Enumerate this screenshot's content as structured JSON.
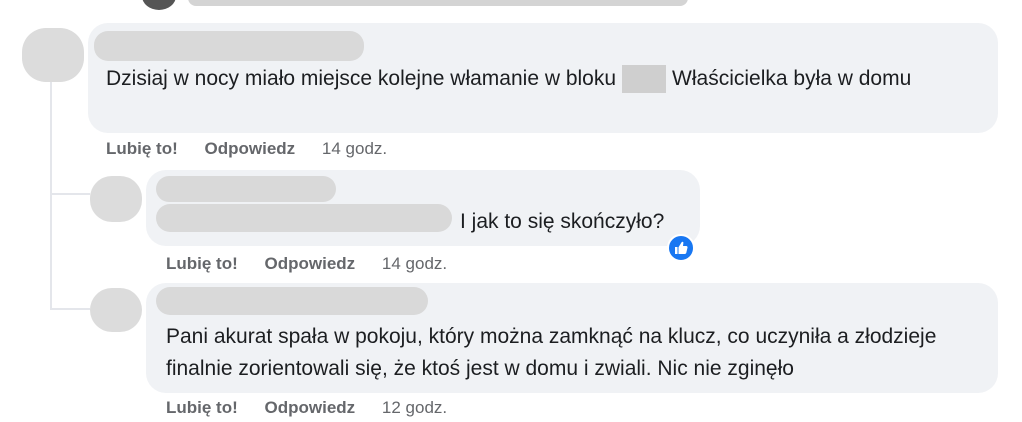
{
  "comments": [
    {
      "text_before_redaction": "Dzisiaj w nocy miało miejsce kolejne włamanie w bloku",
      "text_after_redaction": "Właścicielka była w domu",
      "like_label": "Lubię to!",
      "reply_label": "Odpowiedz",
      "time": "14 godz."
    },
    {
      "text": "I jak to się skończyło?",
      "like_label": "Lubię to!",
      "reply_label": "Odpowiedz",
      "time": "14 godz.",
      "reaction_icon": "thumbs-up-icon"
    },
    {
      "text": "Pani akurat spała w pokoju, który można zamknąć na klucz, co uczyniła a złodzieje finalnie zorientowali się, że ktoś jest w domu i zwiali. Nic nie zginęło",
      "like_label": "Lubię to!",
      "reply_label": "Odpowiedz",
      "time": "12 godz."
    }
  ],
  "colors": {
    "bubble": "#f0f2f5",
    "action_text": "#65676b",
    "like_badge": "#1877f2"
  }
}
